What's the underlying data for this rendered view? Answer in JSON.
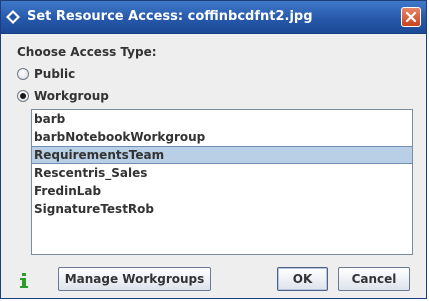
{
  "window": {
    "title": "Set Resource Access: coffinbcdfnt2.jpg",
    "title_icon": "diamond-app-icon",
    "close_icon": "close-icon"
  },
  "access": {
    "heading": "Choose Access Type:",
    "options": [
      {
        "label": "Public",
        "selected": false
      },
      {
        "label": "Workgroup",
        "selected": true
      }
    ]
  },
  "workgroups": {
    "items": [
      "barb",
      "barbNotebookWorkgroup",
      "RequirementsTeam",
      "Rescentris_Sales",
      "FredinLab",
      "SignatureTestRob"
    ],
    "selected_index": 2
  },
  "footer": {
    "info_icon": "info-icon",
    "manage_label": "Manage Workgroups",
    "ok_label": "OK",
    "cancel_label": "Cancel"
  },
  "colors": {
    "titlebar": "#2556a8",
    "selection": "#b8cfe5",
    "info_green": "#2a9d2a",
    "close_red": "#d05a34"
  }
}
